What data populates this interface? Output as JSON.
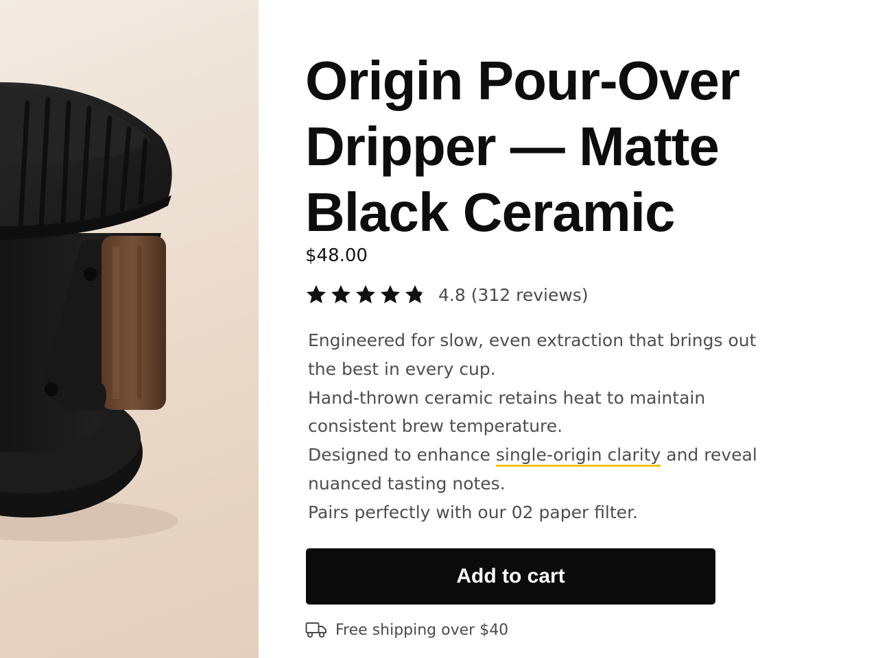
{
  "product": {
    "title_lines": [
      "Origin Pour-Over",
      "Dripper — Matte",
      "Black Ceramic"
    ],
    "price": "$48.00",
    "rating": {
      "value": 4.8,
      "max": 5,
      "text": "4.8 (312 reviews)",
      "star_color": "#111111",
      "empty_star_color": "#c9c9c9"
    },
    "description": {
      "line1": "Engineered for slow, even extraction that brings out the best in every cup.",
      "line2": "Hand-thrown ceramic retains heat to maintain consistent brew temperature.",
      "line3_before": "Designed to enhance ",
      "line3_highlight": "single-origin clarity",
      "line3_after": " and reveal nuanced tasting notes.",
      "line4": "Pairs perfectly with our 02 paper filter."
    },
    "image": {
      "subject": "matte black ceramic pour-over dripper with walnut handle",
      "background_color": "#ecdfd2"
    }
  },
  "actions": {
    "add_to_cart_label": "Add to cart"
  },
  "shipping": {
    "icon": "truck-icon",
    "text": "Free shipping over $40"
  },
  "colors": {
    "accent_underline": "#f2c21a",
    "button_bg": "#0b0b0b",
    "button_text": "#ffffff"
  }
}
